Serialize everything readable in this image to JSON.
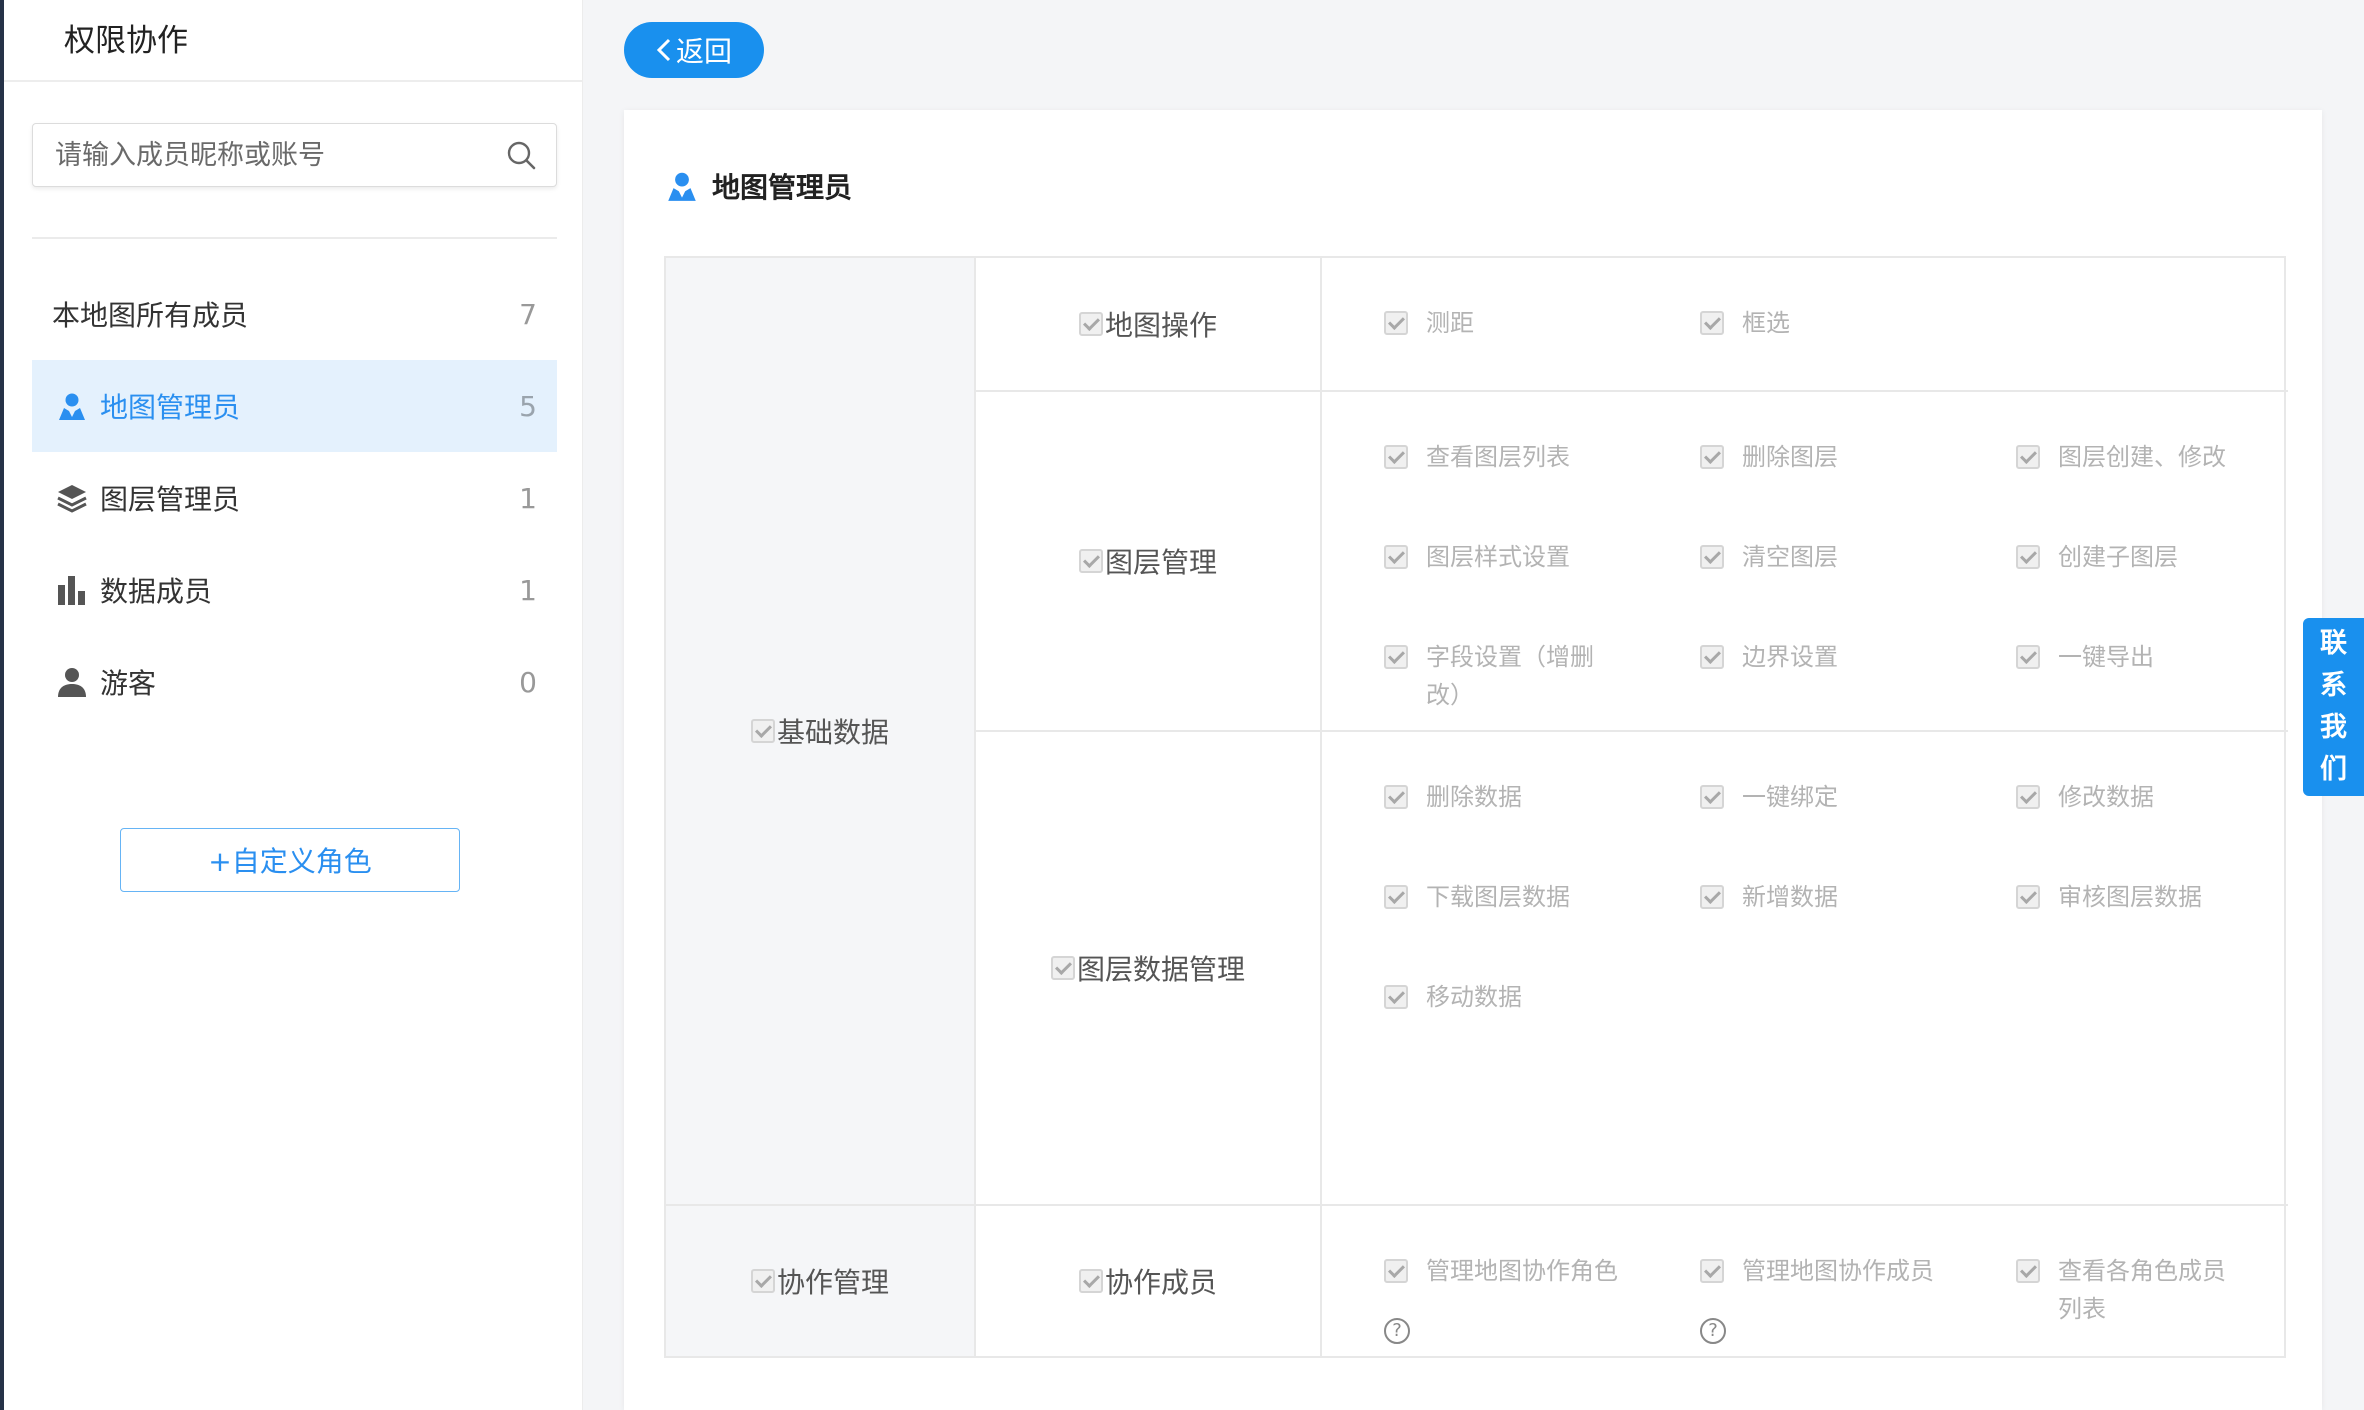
{
  "sidebar": {
    "title": "权限协作",
    "search": {
      "placeholder": "请输入成员昵称或账号",
      "value": ""
    },
    "roles": [
      {
        "label": "本地图所有成员",
        "count": "7",
        "icon": "none",
        "active": false
      },
      {
        "label": "地图管理员",
        "count": "5",
        "icon": "map-user-icon",
        "active": true
      },
      {
        "label": "图层管理员",
        "count": "1",
        "icon": "layers-icon",
        "active": false
      },
      {
        "label": "数据成员",
        "count": "1",
        "icon": "bar-chart-icon",
        "active": false
      },
      {
        "label": "游客",
        "count": "0",
        "icon": "person-icon",
        "active": false
      }
    ],
    "custom_role_button": "+自定义角色"
  },
  "header": {
    "back_label": "返回"
  },
  "panel": {
    "title": "地图管理员",
    "groups": [
      {
        "label": "基础数据",
        "sections": [
          {
            "label": "地图操作",
            "perms": [
              "测距",
              "框选"
            ]
          },
          {
            "label": "图层管理",
            "perms": [
              "查看图层列表",
              "删除图层",
              "图层创建、修改",
              "图层样式设置",
              "清空图层",
              "创建子图层",
              "字段设置（增删改）",
              "边界设置",
              "一键导出"
            ]
          },
          {
            "label": "图层数据管理",
            "perms": [
              "删除数据",
              "一键绑定",
              "修改数据",
              "下载图层数据",
              "新增数据",
              "审核图层数据",
              "移动数据"
            ]
          }
        ]
      },
      {
        "label": "协作管理",
        "sections": [
          {
            "label": "协作成员",
            "perms": [
              "管理地图协作角色",
              "管理地图协作成员",
              "查看各角色成员列表"
            ],
            "help": "?"
          }
        ]
      }
    ]
  },
  "contact": {
    "label": [
      "联",
      "系",
      "我",
      "们"
    ]
  },
  "colors": {
    "accent": "#1990ee",
    "active_bg": "#e4f1fd",
    "sidebar_edge": "#263248"
  }
}
